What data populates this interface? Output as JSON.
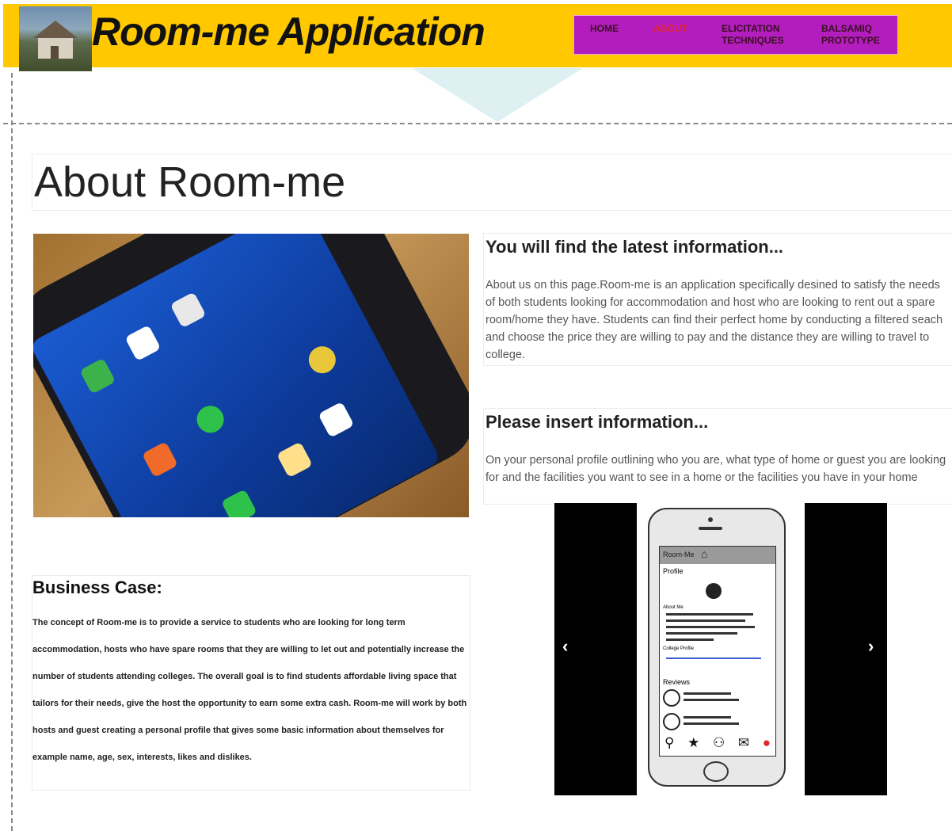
{
  "header": {
    "title": "Room-me Application",
    "logo_icon": "house-photo",
    "background": "#ffc800"
  },
  "nav": {
    "background": "#b31cbd",
    "active_color": "#e3262e",
    "items": [
      {
        "label": "HOME",
        "active": false
      },
      {
        "label": "ABOUT",
        "active": true
      },
      {
        "label": "ELICITATION TECHNIQUES",
        "active": false
      },
      {
        "label": "BALSAMIQ PROTOTYPE",
        "active": false
      }
    ]
  },
  "page": {
    "title": "About Room-me"
  },
  "sections": [
    {
      "heading": "You will find the latest information...",
      "body": "About us on this page.Room-me is an application specifically desined to satisfy the needs of both students looking for accommodation and host who are looking to rent out a spare room/home they have. Students can find their perfect home by conducting a filtered seach and choose the price they are willing to pay and the distance they are willing to travel to college."
    },
    {
      "heading": "Please insert information...",
      "body": "On your personal profile outlining who you are, what type of home or guest you are looking for and the facilities you want to see in a home  or the facilities you have in your home"
    }
  ],
  "business_case": {
    "heading": "Business Case:",
    "body": "The concept of Room-me is to provide a service to students who are looking for long term accommodation, hosts who have spare rooms that they are willing to let out and potentially increase the number of students attending colleges. The overall goal is to find students affordable living space that tailors for their needs, give the host the opportunity to earn some extra cash. Room-me will work by both hosts and guest creating a personal profile that gives some basic information about themselves for example name, age, sex, interests, likes and dislikes."
  },
  "carousel": {
    "prev_icon": "chevron-left-icon",
    "next_icon": "chevron-right-icon",
    "prev_glyph": "‹",
    "next_glyph": "›",
    "mock_app_title": "Room-Me",
    "mock_profile_label": "Profile",
    "mock_about_label": "About Me",
    "mock_college_label": "College Profile",
    "mock_reviews_label": "Reviews"
  }
}
